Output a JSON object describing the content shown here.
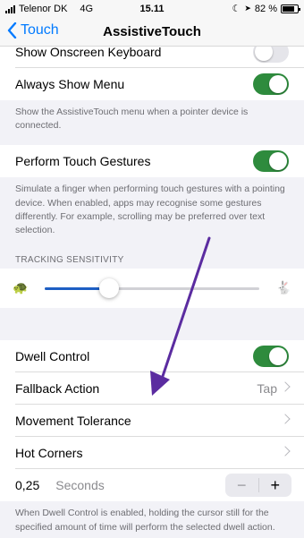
{
  "status": {
    "carrier": "Telenor DK",
    "network": "4G",
    "time": "15.11",
    "battery": "82 %",
    "battery_level": 0.82
  },
  "nav": {
    "back_label": "Touch",
    "title": "AssistiveTouch"
  },
  "rows": {
    "onscreen_keyboard": {
      "label": "Show Onscreen Keyboard",
      "on": false
    },
    "always_show_menu": {
      "label": "Always Show Menu",
      "on": true
    },
    "perform_gestures": {
      "label": "Perform Touch Gestures",
      "on": true
    },
    "dwell_control": {
      "label": "Dwell Control",
      "on": true
    },
    "fallback_action": {
      "label": "Fallback Action",
      "value": "Tap"
    },
    "movement_tolerance": {
      "label": "Movement Tolerance"
    },
    "hot_corners": {
      "label": "Hot Corners"
    },
    "dwell_time": {
      "value": "0,25",
      "unit": "Seconds"
    }
  },
  "notes": {
    "menu": "Show the AssistiveTouch menu when a pointer device is connected.",
    "gestures": "Simulate a finger when performing touch gestures with a pointing device. When enabled, apps may recognise some gestures differently. For example, scrolling may be preferred over text selection.",
    "dwell": "When Dwell Control is enabled, holding the cursor still for the specified amount of time will perform the selected dwell action."
  },
  "tracking": {
    "header": "TRACKING SENSITIVITY",
    "level": 0.3
  },
  "colors": {
    "accent": "#007aff",
    "toggle_on": "#2e8b3d",
    "annotation_arrow": "#5b2ca0",
    "slider_fill": "#1e5fc4"
  }
}
